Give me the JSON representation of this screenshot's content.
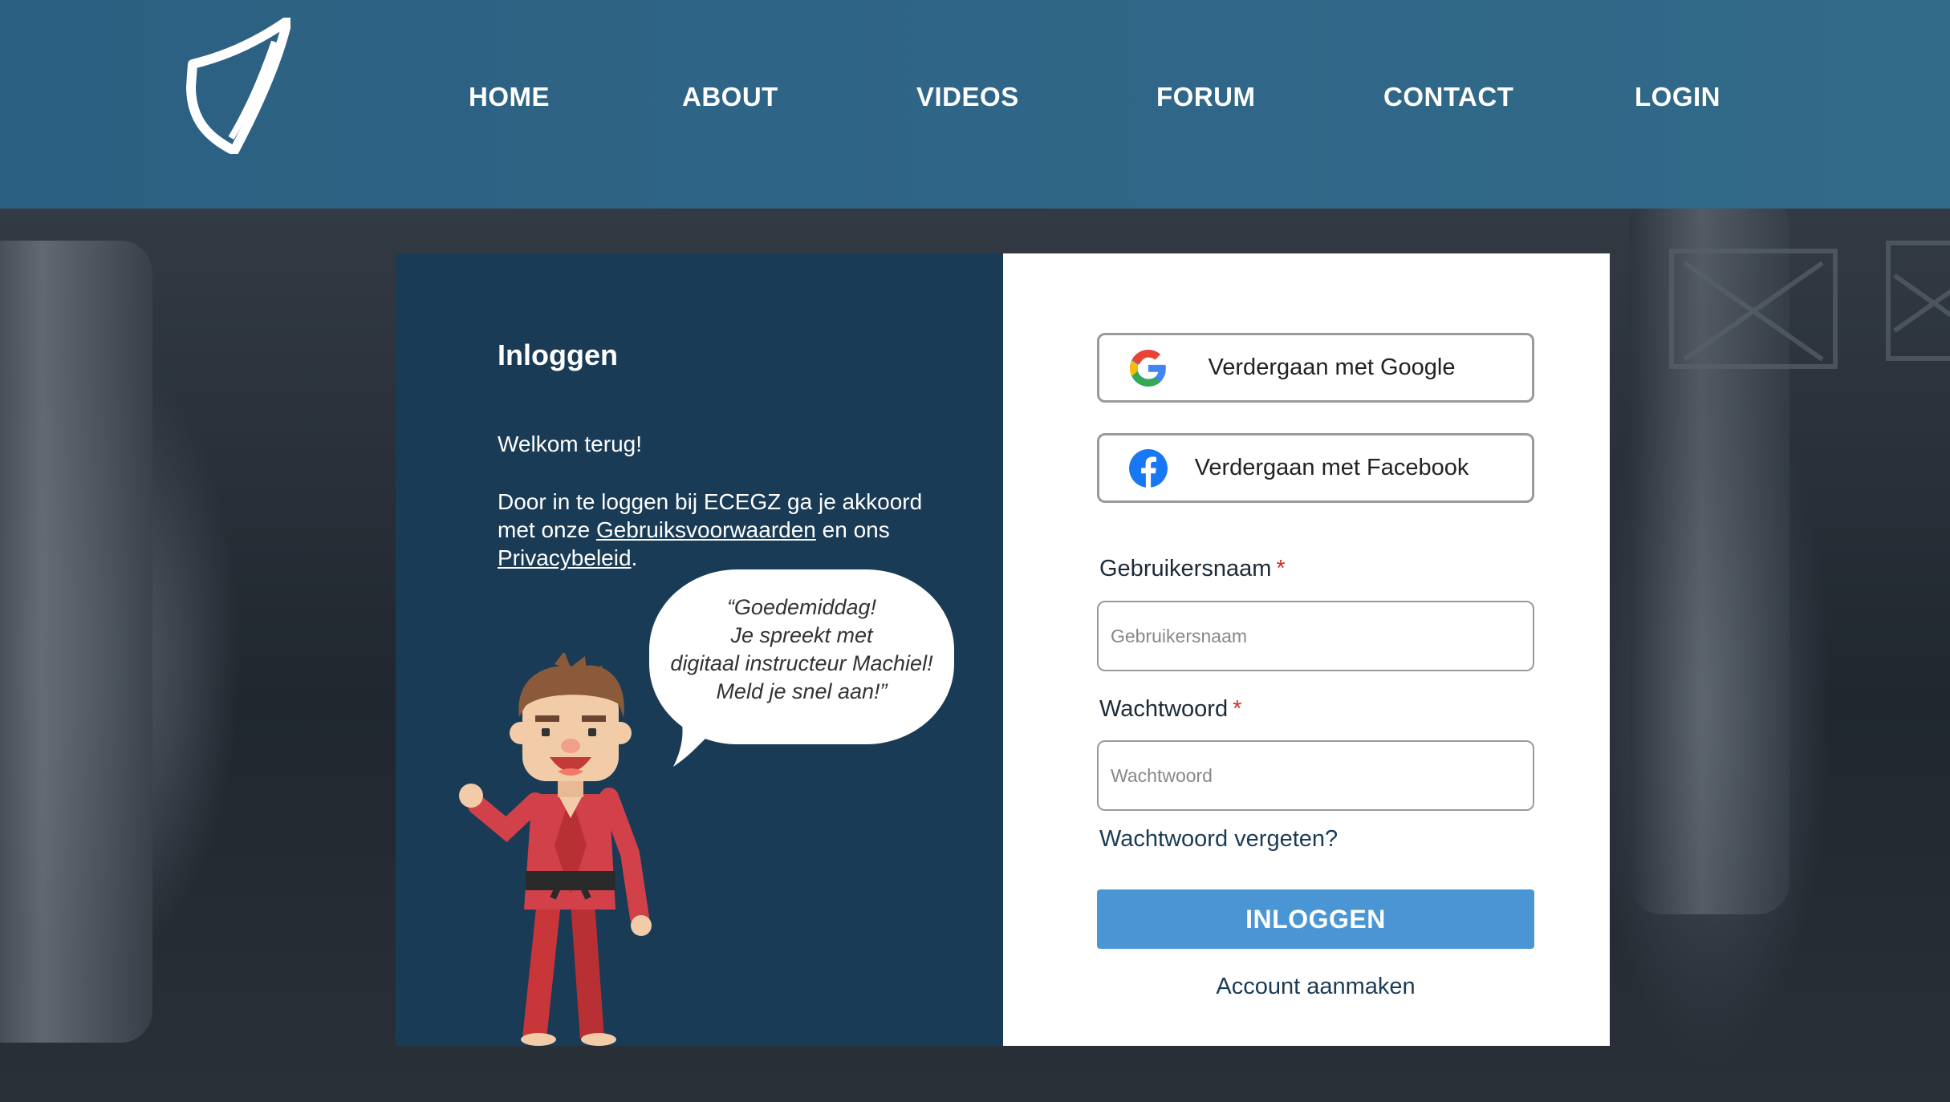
{
  "nav": {
    "home": "HOME",
    "about": "ABOUT",
    "videos": "VIDEOS",
    "forum": "FORUM",
    "contact": "CONTACT",
    "login": "LOGIN"
  },
  "left_panel": {
    "title": "Inloggen",
    "welcome": "Welkom terug!",
    "terms_prefix": "Door in te loggen bij ECEGZ ga je akkoord met onze ",
    "terms_link": "Gebruiksvoorwaarden",
    "terms_middle": " en ons ",
    "privacy_link": "Privacybeleid",
    "terms_suffix": ".",
    "speech": [
      "“Goedemiddag!",
      "Je spreekt met",
      "digitaal instructeur Machiel!",
      "Meld je snel aan!”"
    ]
  },
  "right_panel": {
    "google_label": "Verdergaan met Google",
    "facebook_label": "Verdergaan met Facebook",
    "username_label": "Gebruikersnaam",
    "username_placeholder": "Gebruikersnaam",
    "password_label": "Wachtwoord",
    "password_placeholder": "Wachtwoord",
    "required_mark": "*",
    "forgot": "Wachtwoord vergeten?",
    "login_button": "INLOGGEN",
    "create_account": "Account aanmaken"
  },
  "icons": {
    "logo": "shield-logo-icon",
    "google": "google-icon",
    "facebook": "facebook-icon"
  },
  "colors": {
    "header": "#2c6082",
    "panel_dark": "#1a3b55",
    "button": "#4a96d4",
    "required": "#d0302a"
  }
}
